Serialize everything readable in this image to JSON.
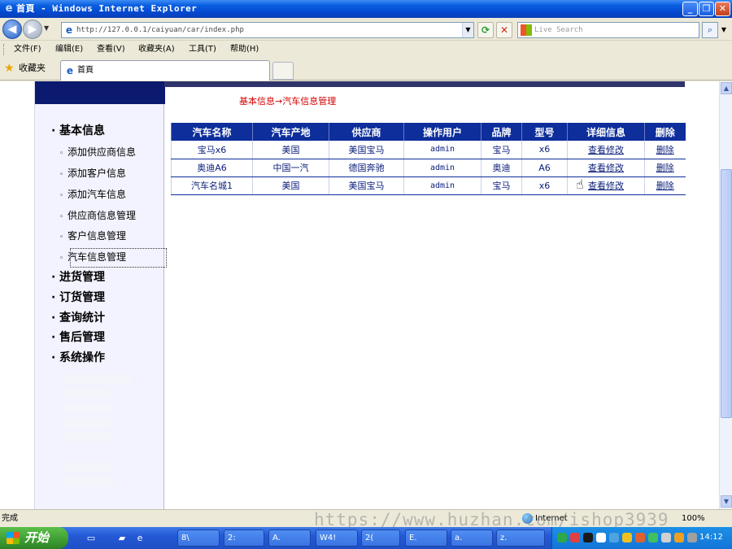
{
  "window": {
    "title": "首頁 - Windows Internet Explorer"
  },
  "toolbar": {
    "url": "http://127.0.0.1/caiyuan/car/index.php",
    "search_placeholder": "Live Search"
  },
  "menu": {
    "items": [
      "文件(F)",
      "编辑(E)",
      "查看(V)",
      "收藏夹(A)",
      "工具(T)",
      "帮助(H)"
    ]
  },
  "favorites": {
    "label": "收藏夹",
    "tab_label": "首頁"
  },
  "sidebar": {
    "group_basic": "基本信息",
    "sub_items": [
      "添加供应商信息",
      "添加客户信息",
      "添加汽车信息",
      "供应商信息管理",
      "客户信息管理",
      "汽车信息管理"
    ],
    "selected_index": 5,
    "groups": [
      "进货管理",
      "订货管理",
      "查询统计",
      "售后管理",
      "系统操作"
    ]
  },
  "main": {
    "breadcrumb": "基本信息→汽车信息管理",
    "table": {
      "headers": [
        "汽车名称",
        "汽车产地",
        "供应商",
        "操作用户",
        "品牌",
        "型号",
        "详细信息",
        "删除"
      ],
      "rows": [
        [
          "宝马x6",
          "美国",
          "美国宝马",
          "admin",
          "宝马",
          "x6",
          "查看修改",
          "删除"
        ],
        [
          "奥迪A6",
          "中国一汽",
          "德国奔驰",
          "admin",
          "奥迪",
          "A6",
          "查看修改",
          "删除"
        ],
        [
          "汽车名城1",
          "美国",
          "美国宝马",
          "admin",
          "宝马",
          "x6",
          "查看修改",
          "删除"
        ]
      ]
    }
  },
  "statusbar": {
    "status": "完成",
    "zone": "Internet",
    "zoom": "100%",
    "watermark": "https://www.huzhan.com/ishop3939"
  },
  "taskbar": {
    "start_label": "开始",
    "tasks": [
      "8\\",
      "2:",
      "A.",
      "W4!",
      "2(",
      "E.",
      "a.",
      "z."
    ],
    "clock": "14:12"
  },
  "colors": {
    "table_header": "#0d2e9b",
    "breadcrumb": "#d00000",
    "sidebar_header": "#0b1a6e",
    "taskbar": "#2459d6"
  }
}
